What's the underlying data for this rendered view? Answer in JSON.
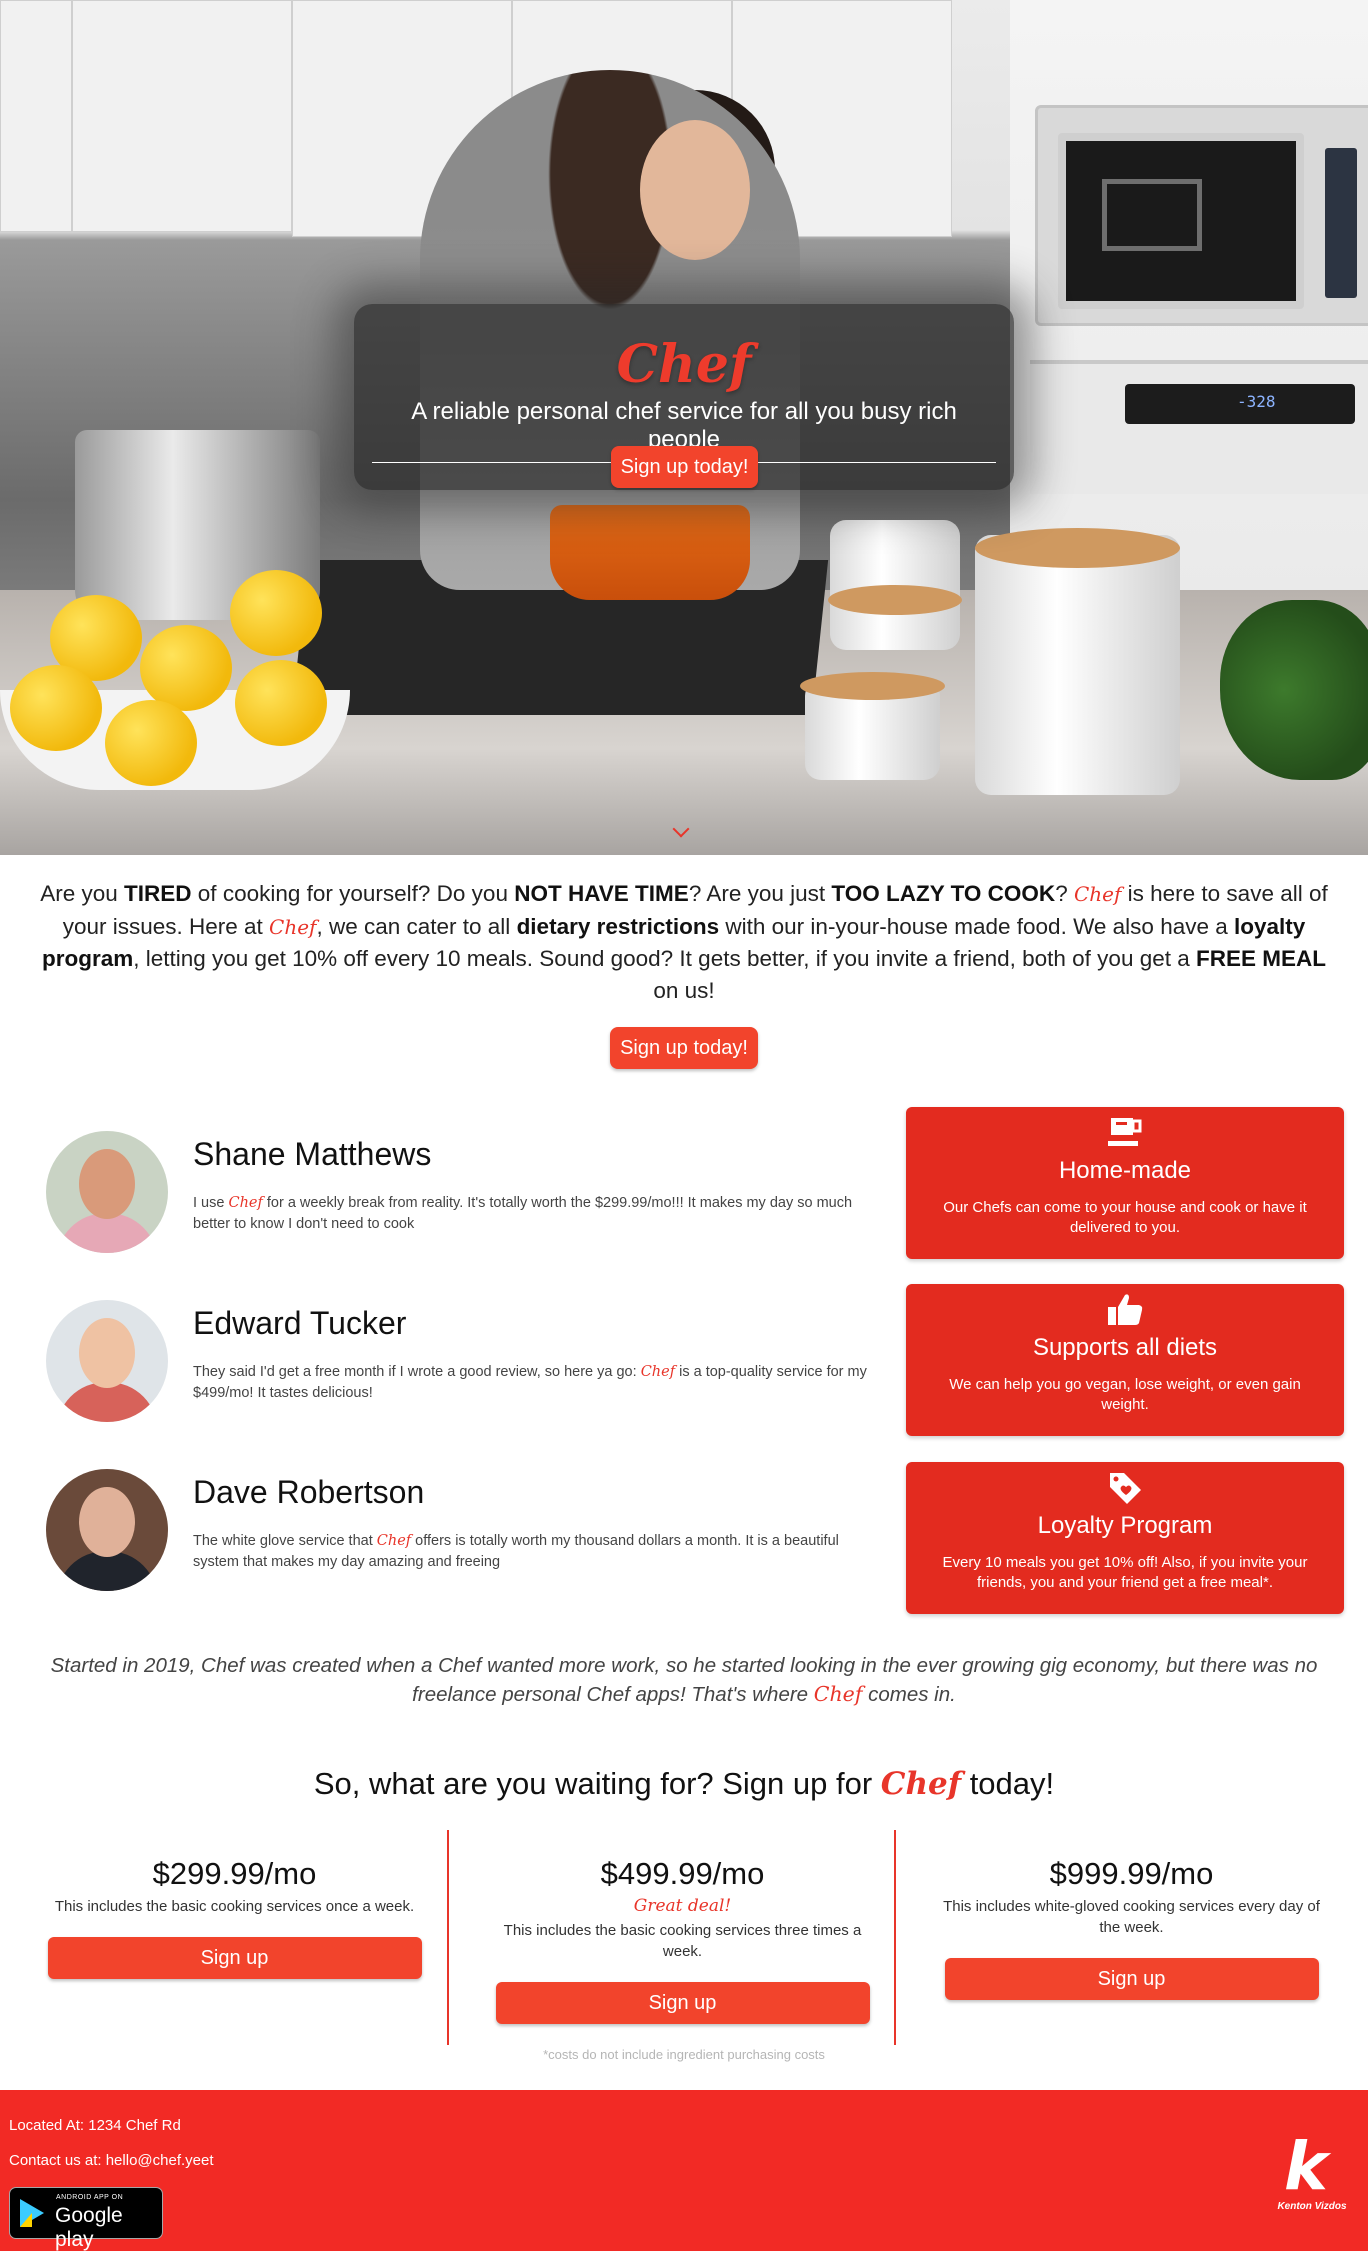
{
  "hero": {
    "brand": "Chef",
    "tagline": "A reliable personal chef service for all you busy rich people",
    "signup_label": "Sign up today!",
    "oven_display": "-328"
  },
  "intro": {
    "t1": "Are you ",
    "b1": "TIRED",
    "t2": " of cooking for yourself? Do you ",
    "b2": "NOT HAVE TIME",
    "t3": "? Are you just ",
    "b3": "TOO LAZY TO COOK",
    "t4": "? ",
    "brand1": "Chef",
    "t5": " is here to save all of your issues. Here at ",
    "brand2": "Chef",
    "t6": ", we can cater to all ",
    "b4": "dietary restrictions",
    "t7": " with our in-your-house made food. We also have a ",
    "b5": "loyalty program",
    "t8": ", letting you get 10% off every 10 meals. Sound good? It gets better, if you invite a friend, both of you get a ",
    "b6": "FREE MEAL",
    "t9": " on us!",
    "signup_label": "Sign up today!"
  },
  "testimonials": [
    {
      "name": "Shane Matthews",
      "q1": "I use ",
      "brand": "Chef",
      "q2": " for a weekly break from reality. It's totally worth the $299.99/mo!!! It makes my day so much better to know I don't need to cook"
    },
    {
      "name": "Edward Tucker",
      "q1": "They said I'd get a free month if I wrote a good review, so here ya go: ",
      "brand": "Chef",
      "q2": " is a top-quality service for my $499/mo! It tastes delicious!"
    },
    {
      "name": "Dave Robertson",
      "q1": "The white glove service that ",
      "brand": "Chef",
      "q2": " offers is totally worth my thousand dollars a month. It is a beautiful system that makes my day amazing and freeing"
    }
  ],
  "features": [
    {
      "icon": "coffee-cup-icon",
      "title": "Home-made",
      "desc": "Our Chefs can come to your house and cook or have it delivered to you."
    },
    {
      "icon": "thumbs-up-icon",
      "title": "Supports all diets",
      "desc": "We can help you go vegan, lose weight, or even gain weight."
    },
    {
      "icon": "tag-heart-icon",
      "title": "Loyalty Program",
      "desc": "Every 10 meals you get 10% off! Also, if you invite your friends, you and your friend get a free meal*."
    }
  ],
  "story": {
    "t1": "Started in 2019, Chef was created when a Chef wanted more work, so he started looking in the ever growing gig economy, but there was no freelance personal Chef apps! That's where ",
    "brand": "Chef",
    "t2": " comes in."
  },
  "cta": {
    "t1": "So, what are you waiting for? Sign up for ",
    "brand": "Chef",
    "t2": " today!"
  },
  "plans": [
    {
      "price": "$299.99/mo",
      "deal": "",
      "desc": "This includes the basic cooking services once a week.",
      "button": "Sign up"
    },
    {
      "price": "$499.99/mo",
      "deal": "Great deal!",
      "desc": "This includes the basic cooking services three times a week.",
      "button": "Sign up"
    },
    {
      "price": "$999.99/mo",
      "deal": "",
      "desc": "This includes white-gloved cooking services every day of the week.",
      "button": "Sign up"
    }
  ],
  "fineprint": "*costs do not include ingredient purchasing costs",
  "footer": {
    "location": "Located At: 1234 Chef Rd",
    "contact": "Contact us at: hello@chef.yeet",
    "gplay_small": "ANDROID APP ON",
    "gplay_big": "Google play",
    "logo_letter": "k",
    "logo_label": "Kenton Vizdos"
  },
  "colors": {
    "accent": "#f2442c",
    "card": "#e32b1f",
    "footer": "#f22a25"
  }
}
